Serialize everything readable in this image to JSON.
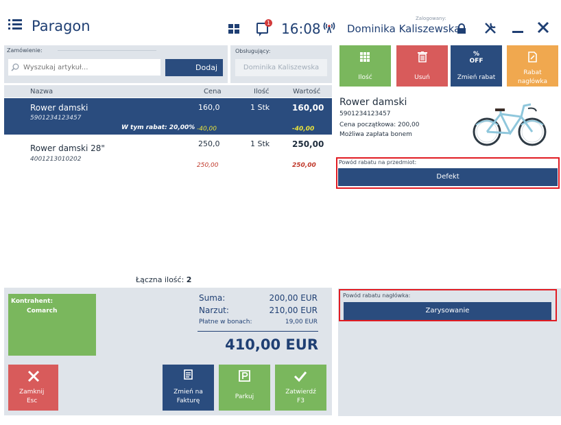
{
  "titlebar": {
    "title": "Paragon",
    "message_badge": "1",
    "time": "16:08",
    "logged_in_caption": "Zalogowany:",
    "user_name": "Dominika Kaliszewska"
  },
  "order": {
    "label": "Zamówienie:",
    "search_placeholder": "Wyszukaj artykuł...",
    "add_label": "Dodaj"
  },
  "server": {
    "label": "Obsługujący:",
    "value": "Dominika Kaliszewska"
  },
  "table": {
    "headers": [
      "Nazwa",
      "Cena",
      "Ilość",
      "Wartość"
    ],
    "rows": [
      {
        "name": "Rower damski",
        "code": "5901234123457",
        "price": "160,0",
        "qty": "1 Stk",
        "value": "160,00",
        "discount_caption": "W tym rabat: 20,00%",
        "discount_price": "-40,00",
        "discount_value": "-40,00"
      },
      {
        "name": "Rower damski 28\"",
        "code": "4001213010202",
        "price": "250,0",
        "qty": "1 Stk",
        "value": "250,00",
        "discount_price": "250,00",
        "discount_value": "250,00"
      }
    ]
  },
  "totals": {
    "qty_label": "Łączna ilość:",
    "qty_value": "2",
    "sum_label": "Suma:",
    "sum_value": "200,00 EUR",
    "markup_label": "Narzut:",
    "markup_value": "210,00 EUR",
    "voucher_label": "Płatne w bonach:",
    "voucher_value": "19,00 EUR",
    "grand_total": "410,00 EUR"
  },
  "customer": {
    "label": "Kontrahent:",
    "value": "Comarch"
  },
  "bottom_buttons": {
    "close_line1": "Zamknij",
    "close_line2": "Esc",
    "invoice_line1": "Zmień na",
    "invoice_line2": "Fakturę",
    "park": "Parkuj",
    "confirm_line1": "Zatwierdź",
    "confirm_line2": "F3"
  },
  "actions": {
    "qty": "Ilość",
    "delete": "Usuń",
    "discount": "Zmień rabat",
    "discount_icon_text": "OFF",
    "header_line1": "Rabat",
    "header_line2": "nagłówka"
  },
  "detail": {
    "name": "Rower damski",
    "code": "5901234123457",
    "initial_price": "Cena początkowa: 200,00",
    "voucher_note": "Możliwa zapłata bonem"
  },
  "item_reason": {
    "label": "Powód rabatu na przedmiot:",
    "value": "Defekt"
  },
  "header_reason": {
    "label": "Powód rabatu nagłówka:",
    "value": "Zarysowanie"
  },
  "colors": {
    "navy": "#2a4c7e",
    "green": "#7ab75d",
    "red": "#d85b5b",
    "orange": "#f0a84f",
    "highlight_border": "#e11b22"
  }
}
